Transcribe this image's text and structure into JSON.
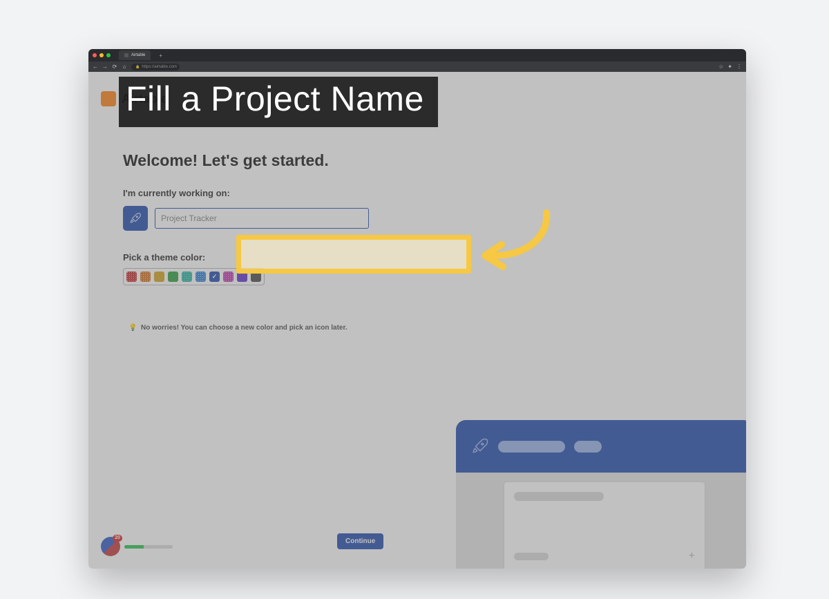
{
  "annotation": {
    "title": "Fill a Project Name"
  },
  "browser": {
    "tab_title": "Airtable",
    "url_display": "https://airtable.com"
  },
  "page": {
    "brand": "Airtable",
    "welcome_heading": "Welcome! Let's get started.",
    "working_on_label": "I'm currently working on:",
    "project_input_placeholder": "Project Tracker",
    "pick_theme_label": "Pick a theme color:",
    "hint_text": "No worries! You can choose a new color and pick an icon later.",
    "continue_label": "Continue"
  },
  "theme_colors": [
    {
      "hex": "#c83b3b",
      "hatched": true,
      "selected": false
    },
    {
      "hex": "#d97b2d",
      "hatched": true,
      "selected": false
    },
    {
      "hex": "#d7a92a",
      "hatched": false,
      "selected": false
    },
    {
      "hex": "#3aa64a",
      "hatched": false,
      "selected": false
    },
    {
      "hex": "#2fb8a6",
      "hatched": true,
      "selected": false
    },
    {
      "hex": "#3a87d9",
      "hatched": true,
      "selected": false
    },
    {
      "hex": "#2d56b2",
      "hatched": false,
      "selected": true
    },
    {
      "hex": "#c245b4",
      "hatched": true,
      "selected": false
    },
    {
      "hex": "#6a3fcf",
      "hatched": false,
      "selected": false
    },
    {
      "hex": "#555555",
      "hatched": false,
      "selected": false
    }
  ],
  "badge": {
    "count": "20",
    "progress_percent": 40
  }
}
